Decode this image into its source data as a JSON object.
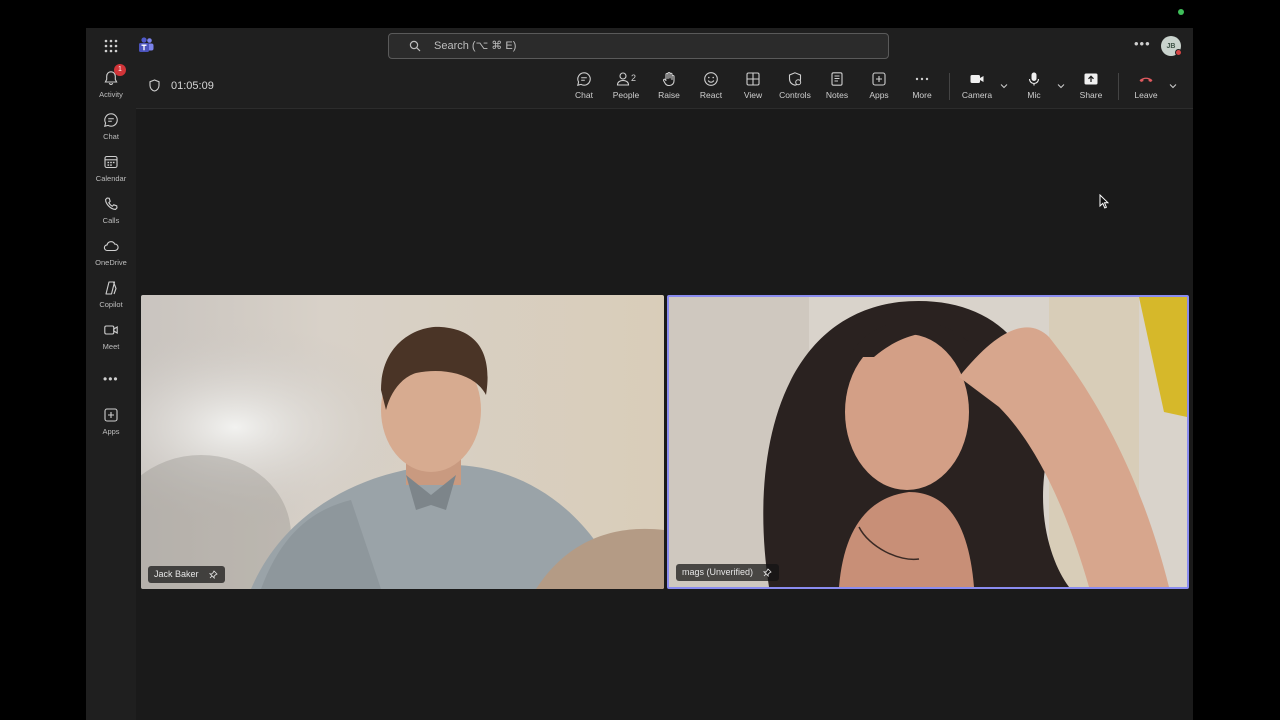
{
  "titlebar": {
    "search_placeholder": "Search (⌥ ⌘ E)",
    "avatar_initials": "JB",
    "more_icon": "more-horizontal-icon",
    "apps_icon": "waffle-grid-icon",
    "logo_icon": "teams-logo-icon"
  },
  "rail": {
    "items": [
      {
        "label": "Activity",
        "icon": "bell-icon",
        "badge": "1"
      },
      {
        "label": "Chat",
        "icon": "chat-icon"
      },
      {
        "label": "Calendar",
        "icon": "calendar-icon"
      },
      {
        "label": "Calls",
        "icon": "phone-icon"
      },
      {
        "label": "OneDrive",
        "icon": "cloud-icon"
      },
      {
        "label": "Copilot",
        "icon": "copilot-icon"
      },
      {
        "label": "Meet",
        "icon": "video-camera-icon"
      },
      {
        "label": "Apps",
        "icon": "add-app-icon"
      }
    ]
  },
  "meeting": {
    "timer": "01:05:09",
    "toolbar": {
      "chat": "Chat",
      "people": "People",
      "people_count": "2",
      "raise": "Raise",
      "react": "React",
      "view": "View",
      "controls": "Controls",
      "notes": "Notes",
      "apps": "Apps",
      "more": "More",
      "camera": "Camera",
      "mic": "Mic",
      "share": "Share",
      "leave": "Leave"
    },
    "participants": [
      {
        "name": "Jack Baker",
        "pinned": true,
        "speaking": false
      },
      {
        "name": "mags (Unverified)",
        "pinned": true,
        "speaking": true
      }
    ]
  },
  "colors": {
    "accent_border": "#8a8cf0",
    "leave_red": "#e05a5f",
    "badge_red": "#d13438",
    "background": "#1f1f1f"
  }
}
